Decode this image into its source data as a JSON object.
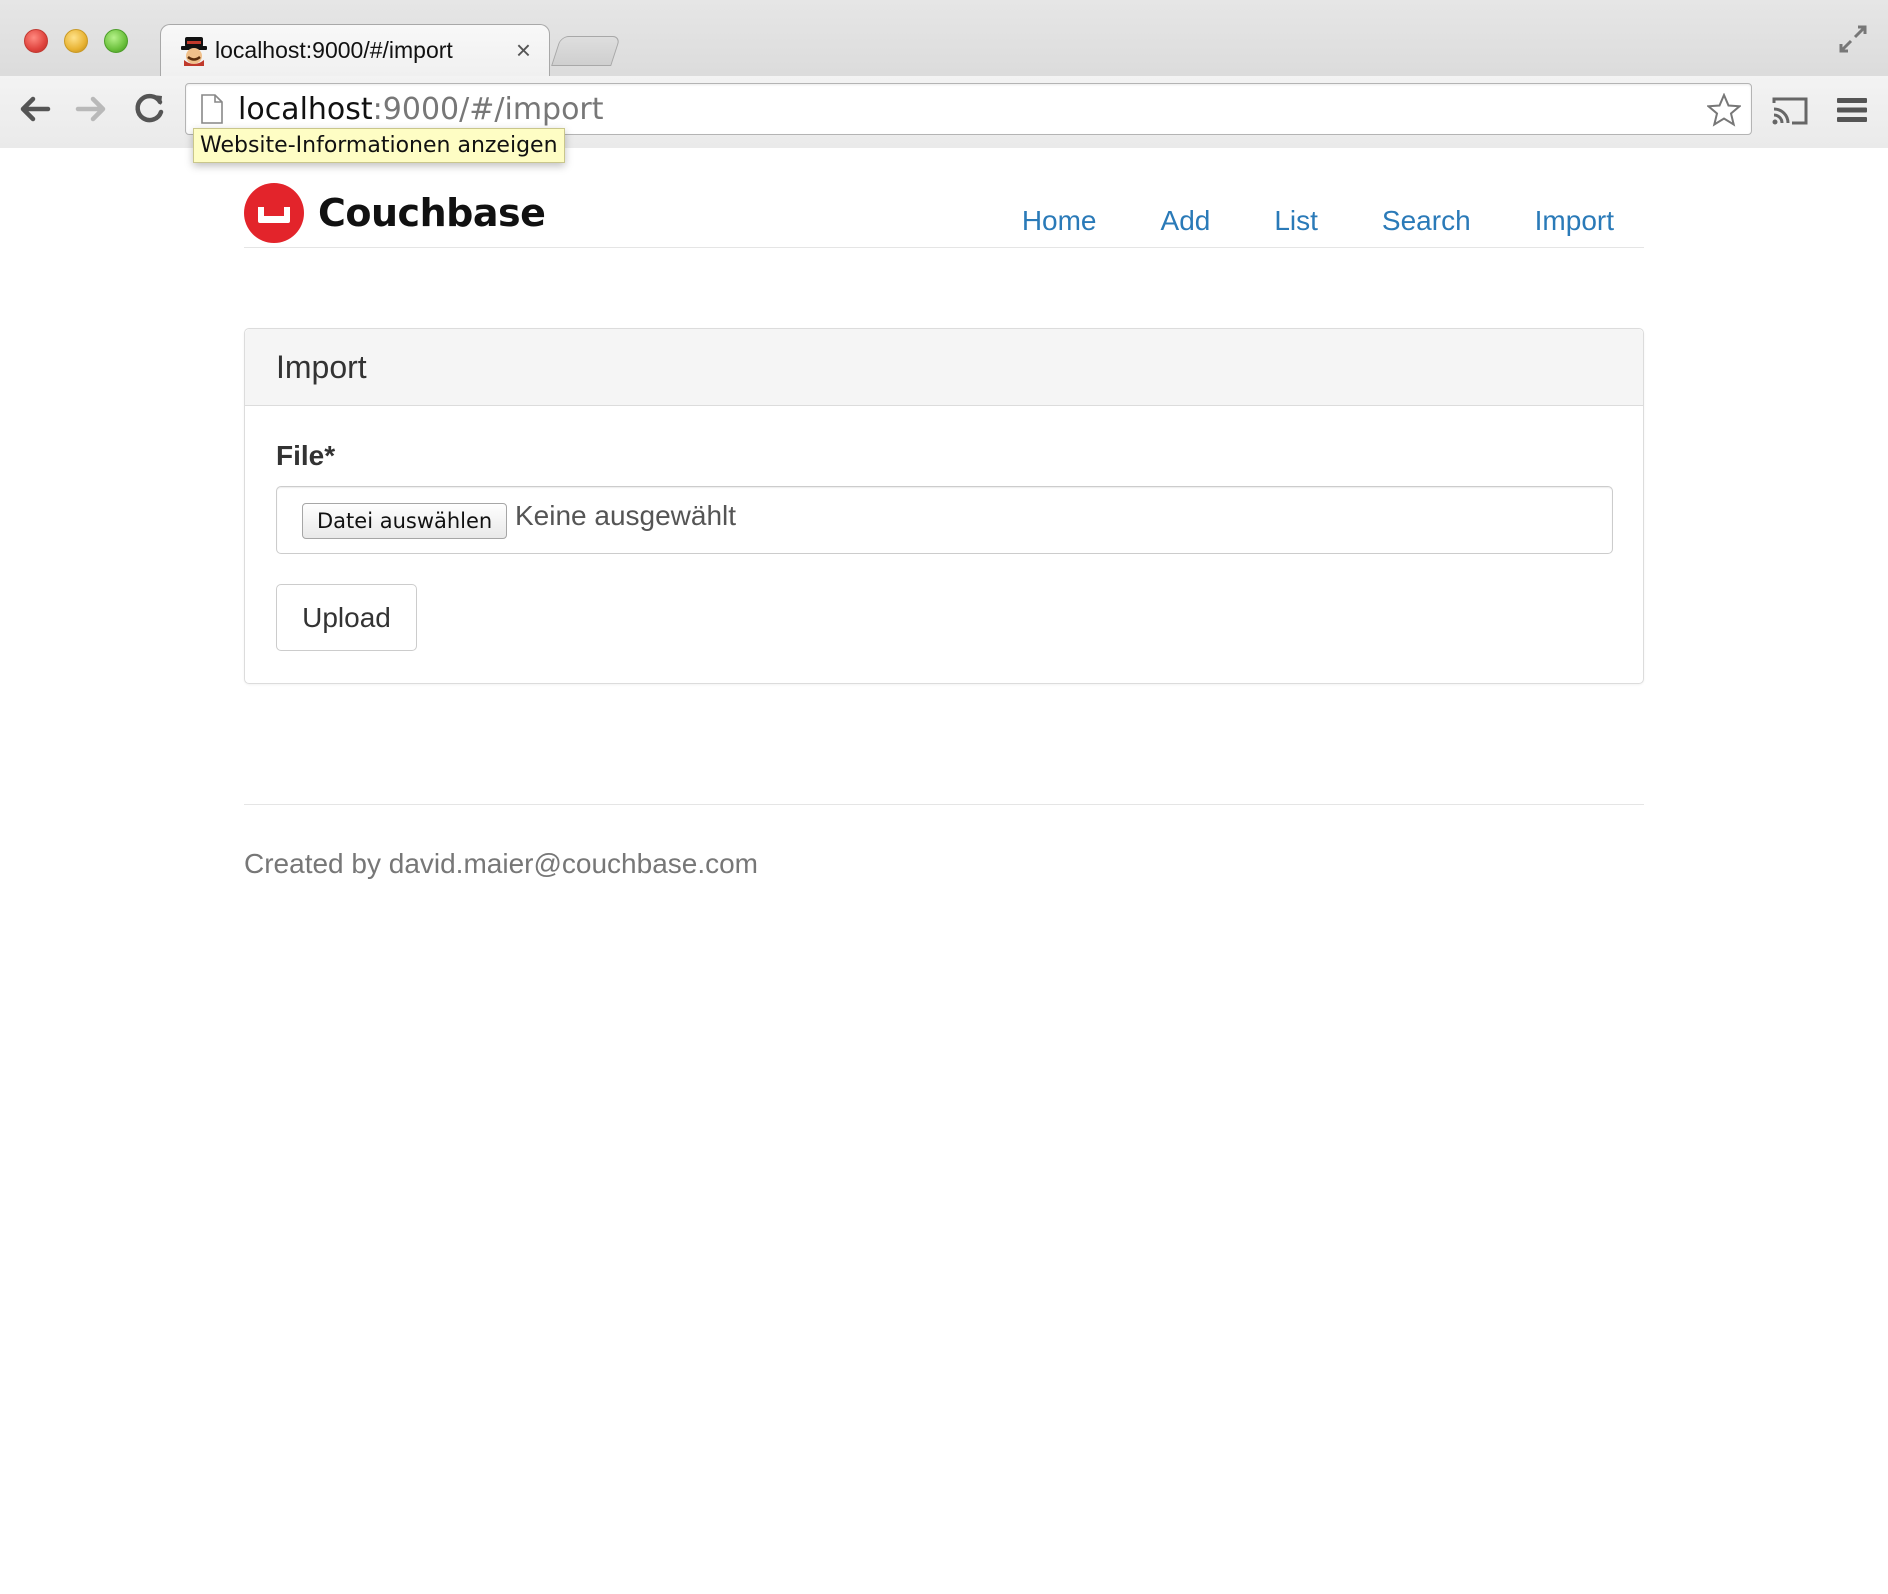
{
  "browser": {
    "tab": {
      "title": "localhost:9000/#/import",
      "close": "×"
    },
    "address_bar": {
      "host": "localhost",
      "rest": ":9000/#/import"
    },
    "tooltip": "Website-Informationen anzeigen"
  },
  "navbar": {
    "brand": "Couchbase",
    "links": [
      {
        "label": "Home"
      },
      {
        "label": "Add"
      },
      {
        "label": "List"
      },
      {
        "label": "Search"
      },
      {
        "label": "Import"
      }
    ]
  },
  "panel": {
    "title": "Import",
    "file_label": "File*",
    "file_input": {
      "button_label": "Datei auswählen",
      "status": "Keine ausgewählt"
    },
    "upload_label": "Upload"
  },
  "footer": {
    "text": "Created by david.maier@couchbase.com"
  },
  "colors": {
    "link": "#2a7ab8",
    "brand_red": "#e3242b",
    "tooltip_bg": "#fefdc4"
  }
}
